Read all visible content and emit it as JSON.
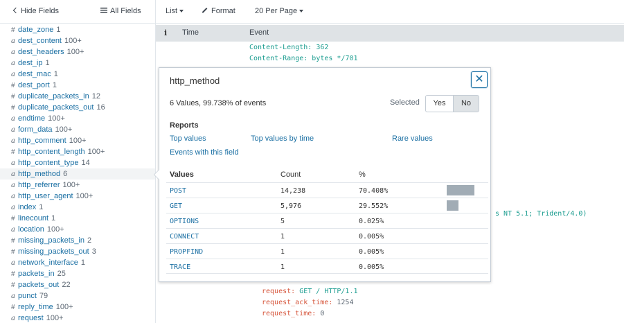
{
  "sidebar": {
    "hide_fields": "Hide Fields",
    "all_fields": "All Fields",
    "fields": [
      {
        "type": "#",
        "name": "date_zone",
        "count": "1"
      },
      {
        "type": "a",
        "name": "dest_content",
        "count": "100+"
      },
      {
        "type": "a",
        "name": "dest_headers",
        "count": "100+"
      },
      {
        "type": "a",
        "name": "dest_ip",
        "count": "1"
      },
      {
        "type": "a",
        "name": "dest_mac",
        "count": "1"
      },
      {
        "type": "#",
        "name": "dest_port",
        "count": "1"
      },
      {
        "type": "#",
        "name": "duplicate_packets_in",
        "count": "12"
      },
      {
        "type": "#",
        "name": "duplicate_packets_out",
        "count": "16"
      },
      {
        "type": "a",
        "name": "endtime",
        "count": "100+"
      },
      {
        "type": "a",
        "name": "form_data",
        "count": "100+"
      },
      {
        "type": "a",
        "name": "http_comment",
        "count": "100+"
      },
      {
        "type": "#",
        "name": "http_content_length",
        "count": "100+"
      },
      {
        "type": "a",
        "name": "http_content_type",
        "count": "14"
      },
      {
        "type": "a",
        "name": "http_method",
        "count": "6"
      },
      {
        "type": "a",
        "name": "http_referrer",
        "count": "100+"
      },
      {
        "type": "a",
        "name": "http_user_agent",
        "count": "100+"
      },
      {
        "type": "a",
        "name": "index",
        "count": "1"
      },
      {
        "type": "#",
        "name": "linecount",
        "count": "1"
      },
      {
        "type": "a",
        "name": "location",
        "count": "100+"
      },
      {
        "type": "#",
        "name": "missing_packets_in",
        "count": "2"
      },
      {
        "type": "#",
        "name": "missing_packets_out",
        "count": "3"
      },
      {
        "type": "a",
        "name": "network_interface",
        "count": "1"
      },
      {
        "type": "#",
        "name": "packets_in",
        "count": "25"
      },
      {
        "type": "#",
        "name": "packets_out",
        "count": "22"
      },
      {
        "type": "a",
        "name": "punct",
        "count": "79"
      },
      {
        "type": "#",
        "name": "reply_time",
        "count": "100+"
      },
      {
        "type": "a",
        "name": "request",
        "count": "100+"
      }
    ]
  },
  "toolbar": {
    "list": "List",
    "format": "Format",
    "per_page": "20 Per Page"
  },
  "events": {
    "header_info": "i",
    "header_time": "Time",
    "header_event": "Event",
    "line1": "Content-Length: 362",
    "line2": "Content-Range: bytes */701",
    "line3": "s NT 5.1; Trident/4.0)",
    "line4_key": "request:",
    "line4_val": "GET / HTTP/1.1",
    "line5_key": "request_ack_time:",
    "line5_val": "1254",
    "line6_key": "request_time:",
    "line6_val": "0"
  },
  "popover": {
    "title": "http_method",
    "summary": "6 Values, 99.738% of events",
    "selected_label": "Selected",
    "yes": "Yes",
    "no": "No",
    "reports_label": "Reports",
    "top_values": "Top values",
    "top_values_by_time": "Top values by time",
    "rare_values": "Rare values",
    "events_with_field": "Events with this field",
    "col_values": "Values",
    "col_count": "Count",
    "col_pct": "%",
    "rows": [
      {
        "value": "POST",
        "count": "14,238",
        "pct": "70.408%",
        "fraction": 0.70408
      },
      {
        "value": "GET",
        "count": "5,976",
        "pct": "29.552%",
        "fraction": 0.29552
      },
      {
        "value": "OPTIONS",
        "count": "5",
        "pct": "0.025%",
        "fraction": 0.00025
      },
      {
        "value": "CONNECT",
        "count": "1",
        "pct": "0.005%",
        "fraction": 5e-05
      },
      {
        "value": "PROPFIND",
        "count": "1",
        "pct": "0.005%",
        "fraction": 5e-05
      },
      {
        "value": "TRACE",
        "count": "1",
        "pct": "0.005%",
        "fraction": 5e-05
      }
    ]
  },
  "colors": {
    "link": "#1a6fa3",
    "teal": "#1a9c8f",
    "red": "#d6563c",
    "bar": "#a1acb5",
    "header_bg": "#dfe3e6"
  }
}
